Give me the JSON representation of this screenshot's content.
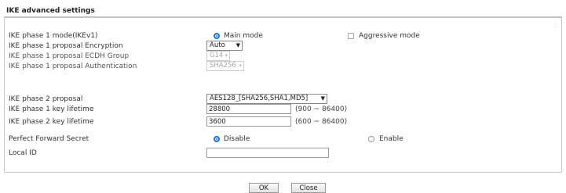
{
  "section_title": "IKE advanced settings",
  "phase1_mode": {
    "label": "IKE phase 1 mode(IKEv1)",
    "main": "Main mode",
    "aggressive": "Aggressive mode"
  },
  "phase1_encryption": {
    "label": "IKE phase 1 proposal Encryption",
    "value": "Auto"
  },
  "phase1_ecdh": {
    "label": "IKE phase 1 proposal ECDH Group",
    "value": "G14"
  },
  "phase1_auth": {
    "label": "IKE phase 1 proposal Authentication",
    "value": "SHA256"
  },
  "phase2_proposal": {
    "label": "IKE phase 2 proposal",
    "value": "AES128_[SHA256,SHA1,MD5]"
  },
  "phase1_lifetime": {
    "label": "IKE phase 1 key lifetime",
    "value": "28800",
    "range": "(900 ~ 86400)"
  },
  "phase2_lifetime": {
    "label": "IKE phase 2 key lifetime",
    "value": "3600",
    "range": "(600 ~ 86400)"
  },
  "pfs": {
    "label": "Perfect Forward Secret",
    "disable": "Disable",
    "enable": "Enable"
  },
  "local_id": {
    "label": "Local ID",
    "value": ""
  },
  "buttons": {
    "ok": "OK",
    "close": "Close"
  }
}
